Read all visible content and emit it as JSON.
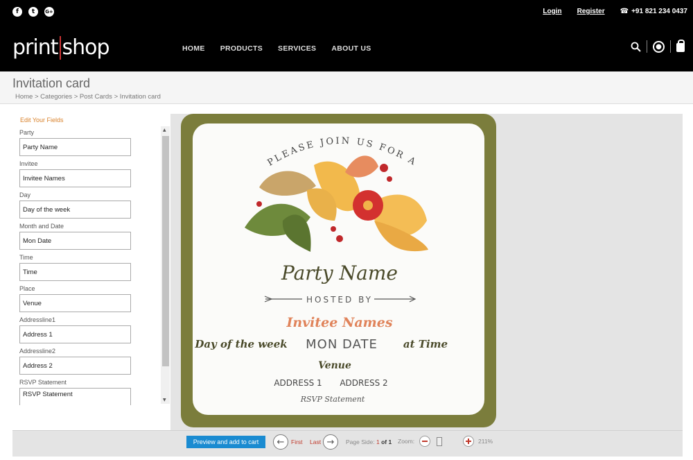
{
  "header": {
    "social": [
      {
        "name": "facebook-icon",
        "glyph": "f"
      },
      {
        "name": "twitter-icon",
        "glyph": "t"
      },
      {
        "name": "google-plus-icon",
        "glyph": "G+"
      }
    ],
    "login": "Login",
    "register": "Register",
    "phone": "+91 821 234 0437",
    "logo_left": "print",
    "logo_right": "shop",
    "nav": [
      "HOME",
      "PRODUCTS",
      "SERVICES",
      "ABOUT US"
    ]
  },
  "page": {
    "title": "Invitation card",
    "breadcrumb": "Home > Categories > Post Cards > Invitation card"
  },
  "editor": {
    "panel_heading": "Edit Your Fields",
    "fields": [
      {
        "label": "Party",
        "value": "Party Name"
      },
      {
        "label": "Invitee",
        "value": "Invitee Names"
      },
      {
        "label": "Day",
        "value": "Day of the week"
      },
      {
        "label": "Month and Date",
        "value": "Mon Date"
      },
      {
        "label": "Time",
        "value": "Time"
      },
      {
        "label": "Place",
        "value": "Venue"
      },
      {
        "label": "Addressline1",
        "value": "Address  1"
      },
      {
        "label": "Addressline2",
        "value": "Address  2"
      },
      {
        "label": "RSVP Statement",
        "value": "RSVP Statement"
      }
    ]
  },
  "card": {
    "arc_text": "PLEASE JOIN US FOR A",
    "party_name": "Party Name",
    "hosted_by": "HOSTED BY",
    "invitee": "Invitee Names",
    "day": "Day of the week",
    "date": "MON DATE",
    "time": "at Time",
    "venue": "Venue",
    "address1": "ADDRESS  1",
    "address2": "ADDRESS  2",
    "rsvp": "RSVP Statement",
    "colors": {
      "frame": "#7b7d3c",
      "script": "#4a4a2a",
      "accent": "#e0835a"
    }
  },
  "toolbar": {
    "preview_label": "Preview and add to cart",
    "first": "First",
    "last": "Last",
    "page_side_label": "Page Side:",
    "page_current": "1",
    "page_of": "of 1",
    "zoom_label": "Zoom:",
    "zoom_pct": "211%"
  }
}
